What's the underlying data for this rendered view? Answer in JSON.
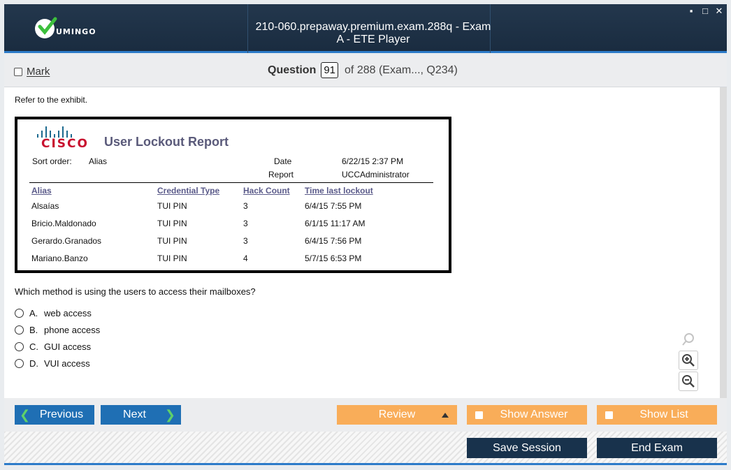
{
  "window": {
    "title": "210-060.prepaway.premium.exam.288q - Exam A - ETE Player",
    "logo_text": "UMINGO",
    "controls": [
      "▪",
      "□",
      "✕"
    ]
  },
  "question_bar": {
    "mark_label": "Mark",
    "question_label": "Question",
    "question_number": "91",
    "of_text": "of 288 (Exam..., Q234)"
  },
  "content": {
    "refer_text": "Refer to the exhibit.",
    "exhibit": {
      "logo_word": "CISCO",
      "title": "User Lockout Report",
      "sort_order_label": "Sort order:",
      "sort_order_value": "Alias",
      "date_label": "Date",
      "date_value": "6/22/15 2:37 PM",
      "report_label": "Report",
      "report_value": "UCCAdministrator",
      "columns": [
        "Alias",
        "Credential Type",
        "Hack Count",
        "Time last lockout"
      ],
      "rows": [
        [
          "Alsaías",
          "TUI PIN",
          "3",
          "6/4/15 7:55 PM"
        ],
        [
          "Bricio.Maldonado",
          "TUI PIN",
          "3",
          "6/1/15 11:17 AM"
        ],
        [
          "Gerardo.Granados",
          "TUI PIN",
          "3",
          "6/4/15 7:56 PM"
        ],
        [
          "Mariano.Banzo",
          "TUI PIN",
          "4",
          "5/7/15 6:53 PM"
        ]
      ]
    },
    "question_text": "Which method is using the users to access their mailboxes?",
    "options": [
      {
        "letter": "A.",
        "text": "web access"
      },
      {
        "letter": "B.",
        "text": "phone access"
      },
      {
        "letter": "C.",
        "text": "GUI access"
      },
      {
        "letter": "D.",
        "text": "VUI access"
      }
    ],
    "zoom_icons": [
      "search-icon",
      "zoom-in-icon",
      "zoom-out-icon"
    ]
  },
  "nav": {
    "previous": "Previous",
    "next": "Next",
    "review": "Review",
    "show_answer": "Show Answer",
    "show_list": "Show List",
    "save_session": "Save Session",
    "end_exam": "End Exam"
  },
  "colors": {
    "titlebar": "#1f3145",
    "accent_blue": "#1f6fb4",
    "orange": "#f9ad59",
    "dark_button": "#18324c",
    "chevron_green": "#5fd06a"
  }
}
